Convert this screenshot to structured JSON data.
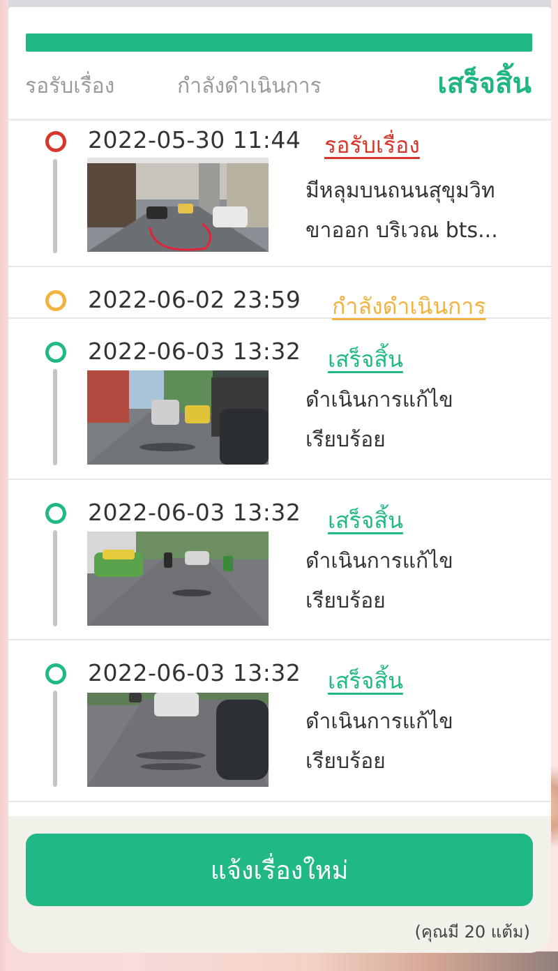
{
  "steps": [
    {
      "label": "รอรับเรื่อง"
    },
    {
      "label": "กำลังดำเนินการ"
    },
    {
      "label": "เสร็จสิ้น"
    }
  ],
  "entries": [
    {
      "time": "2022-05-30 11:44",
      "status": "รอรับเรื่อง",
      "status_color": "#d9362b",
      "desc_line1": "มีหลุมบนถนนสุขุมวิท",
      "desc_line2": "ขาออก บริเวณ bts..."
    },
    {
      "time": "2022-06-02 23:59",
      "status": "กำลังดำเนินการ",
      "status_color": "#f2b33e"
    },
    {
      "time": "2022-06-03 13:32",
      "status": "เสร็จสิ้น",
      "status_color": "#20b884",
      "desc_line1": "ดำเนินการแก้ไข",
      "desc_line2": "เรียบร้อย"
    },
    {
      "time": "2022-06-03 13:32",
      "status": "เสร็จสิ้น",
      "status_color": "#20b884",
      "desc_line1": "ดำเนินการแก้ไข",
      "desc_line2": "เรียบร้อย"
    },
    {
      "time": "2022-06-03 13:32",
      "status": "เสร็จสิ้น",
      "status_color": "#20b884",
      "desc_line1": "ดำเนินการแก้ไข",
      "desc_line2": "เรียบร้อย"
    }
  ],
  "footer": {
    "new_report_label": "แจ้งเรื่องใหม่",
    "points_text": "(คุณมี 20 แต้ม)"
  },
  "colors": {
    "accent": "#20b884",
    "pending": "#d9362b",
    "in_progress": "#f2b33e"
  }
}
